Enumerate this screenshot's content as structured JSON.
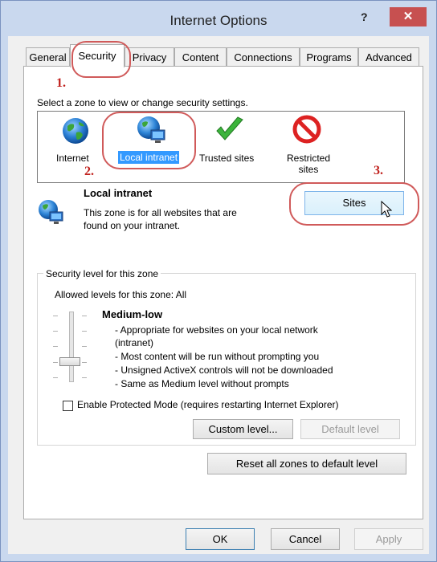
{
  "window": {
    "title": "Internet Options",
    "help_label": "?",
    "close_label": "✕"
  },
  "tabs": [
    {
      "label": "General"
    },
    {
      "label": "Security"
    },
    {
      "label": "Privacy"
    },
    {
      "label": "Content"
    },
    {
      "label": "Connections"
    },
    {
      "label": "Programs"
    },
    {
      "label": "Advanced"
    }
  ],
  "annotations": {
    "step1": "1.",
    "step2": "2.",
    "step3": "3."
  },
  "zones": {
    "prompt": "Select a zone to view or change security settings.",
    "items": [
      {
        "label": "Internet",
        "icon": "globe-icon"
      },
      {
        "label": "Local intranet",
        "icon": "intranet-icon"
      },
      {
        "label": "Trusted sites",
        "icon": "checkmark-icon"
      },
      {
        "label": "Restricted sites",
        "label_line1": "Restricted",
        "label_line2": "sites",
        "icon": "restricted-icon"
      }
    ]
  },
  "zone_info": {
    "title": "Local intranet",
    "description_line1": "This zone is for all websites that are",
    "description_line2": "found on your intranet.",
    "sites_button": "Sites"
  },
  "security_level": {
    "group_title": "Security level for this zone",
    "allowed": "Allowed levels for this zone: All",
    "level_name": "Medium-low",
    "desc": [
      "- Appropriate for websites on your local network",
      "(intranet)",
      "- Most content will be run without prompting you",
      "- Unsigned ActiveX controls will not be downloaded",
      "- Same as Medium level without prompts"
    ],
    "protected_mode": "Enable Protected Mode (requires restarting Internet Explorer)",
    "custom_level": "Custom level...",
    "default_level": "Default level"
  },
  "reset_button": "Reset all zones to default level",
  "footer": {
    "ok": "OK",
    "cancel": "Cancel",
    "apply": "Apply"
  },
  "colors": {
    "selection": "#3399ff",
    "annotation": "#c0201c",
    "close_button": "#c75050"
  }
}
